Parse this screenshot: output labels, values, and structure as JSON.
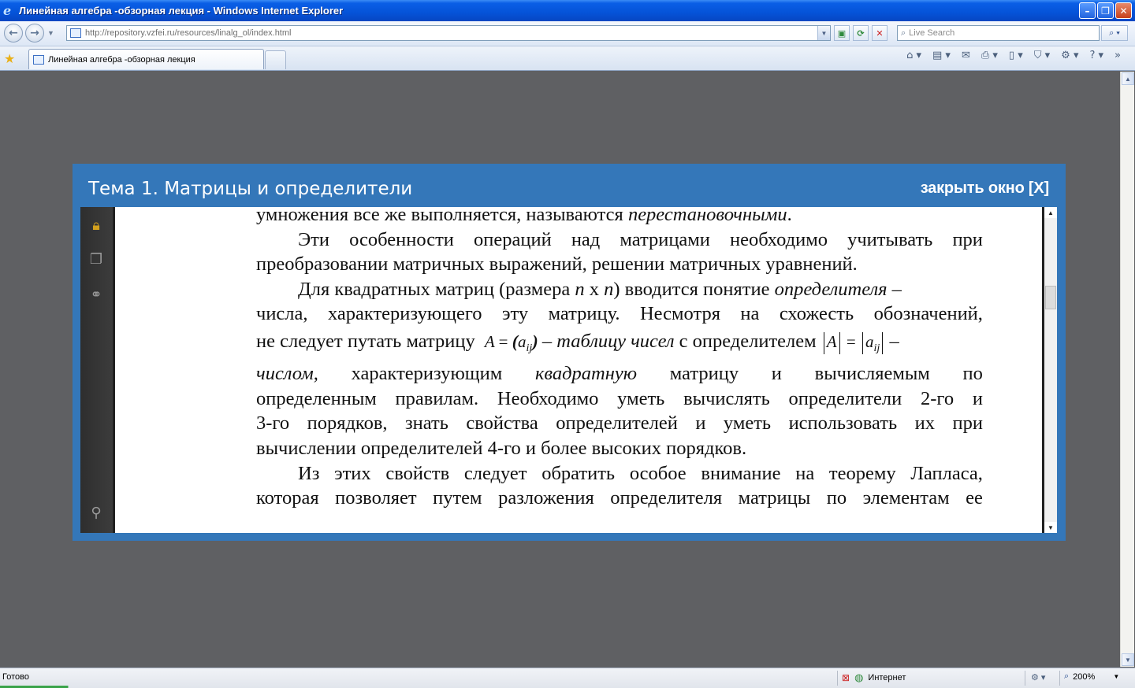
{
  "window": {
    "title": "Линейная алгебра -обзорная лекция - Windows Internet Explorer"
  },
  "address": {
    "url": "http://repository.vzfei.ru/resources/linalg_ol/index.html"
  },
  "search": {
    "placeholder": "Live Search"
  },
  "tab": {
    "label": "Линейная алгебра -обзорная лекция"
  },
  "modal": {
    "title": "Тема 1. Матрицы и определители",
    "close_label": "закрыть окно [X]"
  },
  "document": {
    "l1a": "умножения все же выполняется, называются ",
    "l1b": "перестановочными",
    "l1c": ".",
    "l2": [
      "Эти",
      "особенности",
      "операций",
      "над",
      "матрицами",
      "необходимо",
      "учитывать",
      "при"
    ],
    "l3": "преобразовании матричных выражений, решении матричных уравнений.",
    "l4a": "Для квадратных матриц (размера ",
    "l4b": "n",
    "l4c": " x ",
    "l4d": "n",
    "l4e": ") вводится понятие ",
    "l4f": "определителя",
    "l4g": " –",
    "l5": [
      "числа,",
      "характеризующего",
      "эту",
      "матрицу.",
      "Несмотря",
      "на",
      "схожесть",
      "обозначений,"
    ],
    "l6a": "не следует путать матрицу",
    "f_A": "A",
    "f_eq": "=",
    "f_a": "a",
    "f_ij": "ij",
    "l6b": " – ",
    "l6c": "таблицу чисел",
    "l6d": " с определителем ",
    "l6e": " –",
    "l7": [
      "числом,",
      "характеризующим",
      "квадратную",
      "матрицу",
      "и",
      "вычисляемым",
      "по"
    ],
    "l8": [
      "определенным",
      "правилам.",
      "Необходимо",
      "уметь",
      "вычислять",
      "определители",
      "2-го",
      "и"
    ],
    "l9": [
      "3-го",
      "порядков,",
      "знать",
      "свойства",
      "определителей",
      "и",
      "уметь",
      "использовать",
      "их",
      "при"
    ],
    "l10": "вычислении определителей 4-го и более высоких порядков.",
    "l11": [
      "Из",
      "этих",
      "свойств",
      "следует",
      "обратить",
      "особое",
      "внимание",
      "на",
      "теорему",
      "Лапласа,"
    ],
    "l12": [
      "которая",
      "позволяет",
      "путем",
      "разложения",
      "определителя",
      "матрицы",
      "по",
      "элементам",
      "ее"
    ]
  },
  "statusbar": {
    "status": "Готово",
    "zone": "Интернет",
    "zoom": "200%"
  },
  "icons": {
    "app": "ie-logo-icon",
    "back": "back-arrow-icon",
    "forward": "forward-arrow-icon"
  }
}
